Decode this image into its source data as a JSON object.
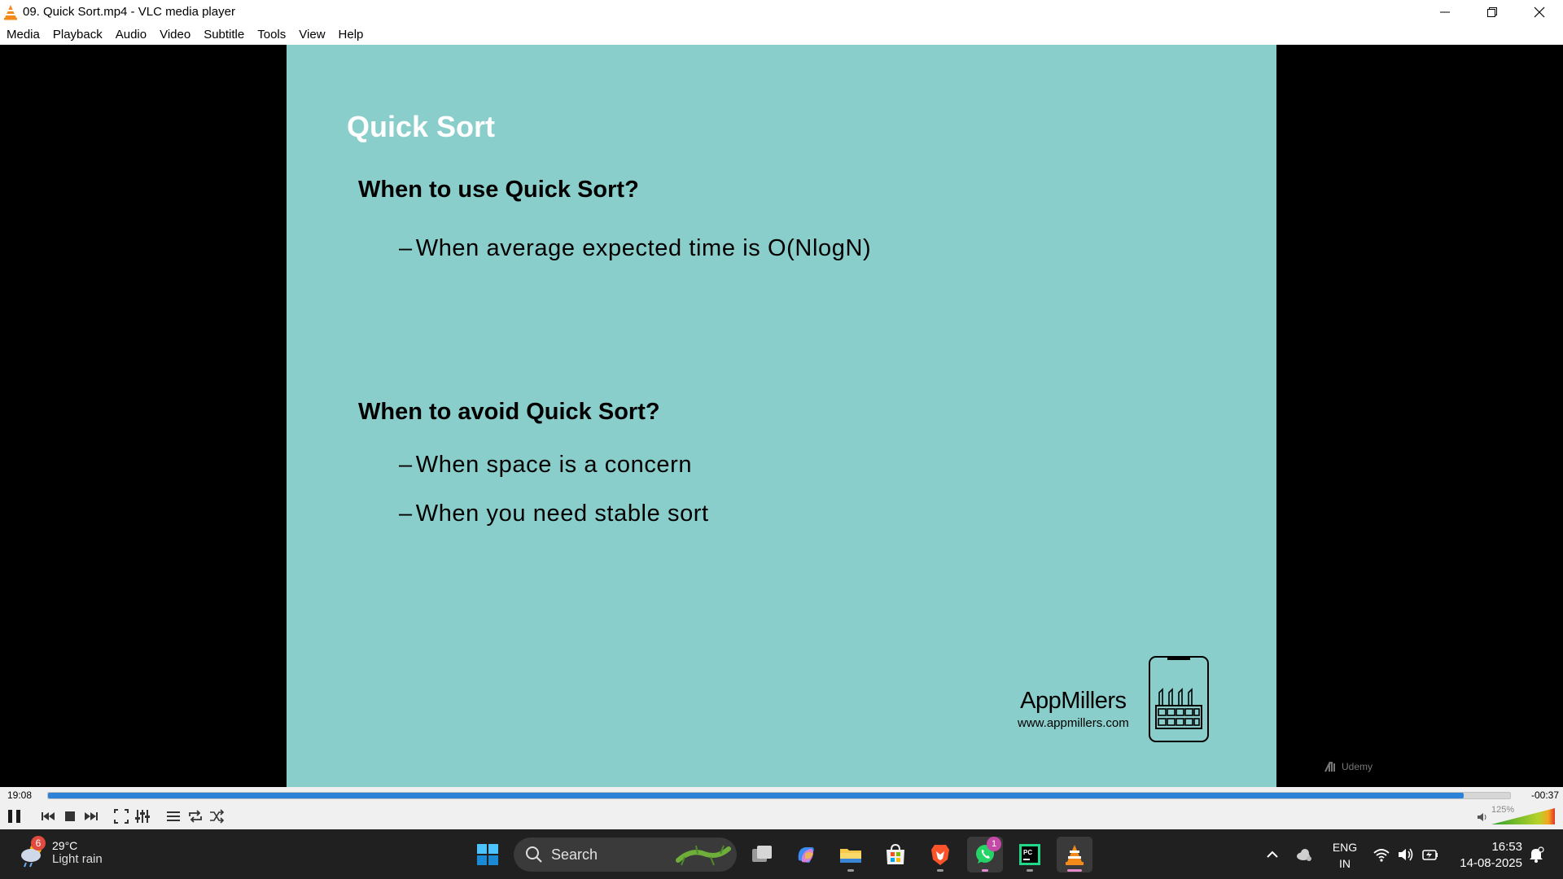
{
  "window": {
    "title": "09. Quick Sort.mp4 - VLC media player"
  },
  "menu": [
    "Media",
    "Playback",
    "Audio",
    "Video",
    "Subtitle",
    "Tools",
    "View",
    "Help"
  ],
  "slide": {
    "title": "Quick Sort",
    "heading1": "When to use Quick Sort?",
    "bullet1": "When average expected time is O(NlogN)",
    "heading2": "When to avoid Quick Sort?",
    "bullet2": "When space is a concern",
    "bullet3": "When you need stable sort",
    "brand_name": "AppMillers",
    "brand_url": "www.appmillers.com",
    "watermark": "Udemy"
  },
  "player": {
    "elapsed": "19:08",
    "remaining": "-00:37",
    "progress_fraction": 0.968,
    "volume_label": "125%",
    "volume_level": 1.25
  },
  "taskbar": {
    "weather_temp": "29°C",
    "weather_desc": "Light rain",
    "weather_badge": "6",
    "search_label": "Search",
    "whatsapp_badge": "1",
    "lang_line1": "ENG",
    "lang_line2": "IN",
    "time": "16:53",
    "date": "14-08-2025"
  },
  "colors": {
    "slide_bg": "#89cecb",
    "seek_fill": "#2d82d8",
    "taskbar_bg": "#202020",
    "vlc_orange": "#f48a1c"
  }
}
